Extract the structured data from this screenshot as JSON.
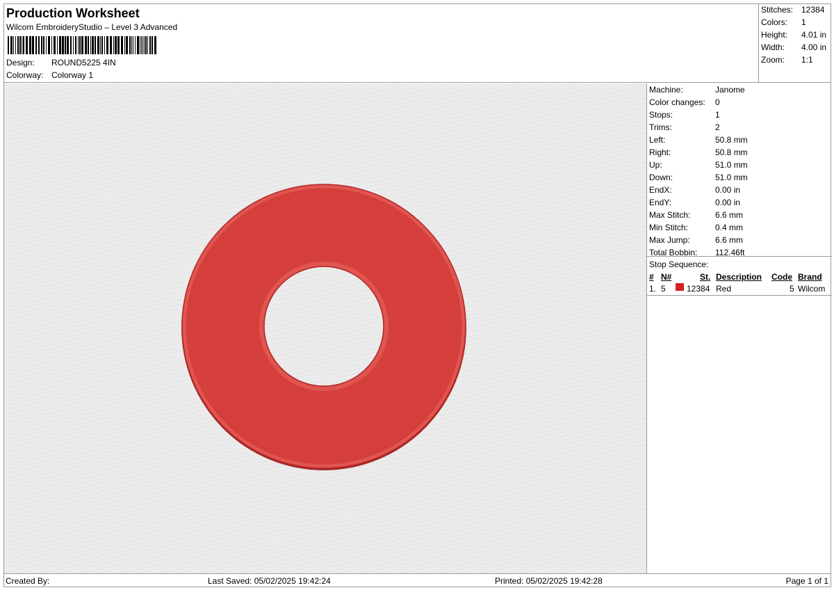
{
  "header": {
    "title": "Production Worksheet",
    "subtitle": "Wilcom EmbroideryStudio – Level 3 Advanced",
    "design_label": "Design:",
    "design_value": "ROUND5225 4IN",
    "colorway_label": "Colorway:",
    "colorway_value": "Colorway 1"
  },
  "stats": [
    {
      "label": "Stitches:",
      "value": "12384"
    },
    {
      "label": "Colors:",
      "value": "1"
    },
    {
      "label": "Height:",
      "value": "4.01 in"
    },
    {
      "label": "Width:",
      "value": "4.00 in"
    },
    {
      "label": "Zoom:",
      "value": "1:1"
    }
  ],
  "details": [
    {
      "label": "Machine:",
      "value": "Janome"
    },
    {
      "label": "Color changes:",
      "value": "0"
    },
    {
      "label": "Stops:",
      "value": "1"
    },
    {
      "label": "Trims:",
      "value": "2"
    },
    {
      "label": "Left:",
      "value": "50.8 mm"
    },
    {
      "label": "Right:",
      "value": "50.8 mm"
    },
    {
      "label": "Up:",
      "value": "51.0 mm"
    },
    {
      "label": "Down:",
      "value": "51.0 mm"
    },
    {
      "label": "EndX:",
      "value": "0.00 in"
    },
    {
      "label": "EndY:",
      "value": "0.00 in"
    },
    {
      "label": "Max Stitch:",
      "value": "6.6 mm"
    },
    {
      "label": "Min Stitch:",
      "value": "0.4 mm"
    },
    {
      "label": "Max Jump:",
      "value": "6.6 mm"
    },
    {
      "label": "Total Bobbin:",
      "value": "112.46ft"
    }
  ],
  "stop_sequence": {
    "title": "Stop Sequence:",
    "headers": {
      "num": "#",
      "n": "N#",
      "st": "St.",
      "description": "Description",
      "code": "Code",
      "brand": "Brand"
    },
    "rows": [
      {
        "num": "1.",
        "n": "5",
        "color": "#d42020",
        "st": "12384",
        "description": "Red",
        "code": "5",
        "brand": "Wilcom"
      }
    ]
  },
  "design_colors": {
    "fill": "#d8413d",
    "edge": "#b32a28",
    "background": "#ececec"
  },
  "footer": {
    "created_by": "Created By:",
    "last_saved": "Last Saved: 05/02/2025 19:42:24",
    "printed": "Printed: 05/02/2025 19:42:28",
    "page": "Page 1 of 1"
  }
}
